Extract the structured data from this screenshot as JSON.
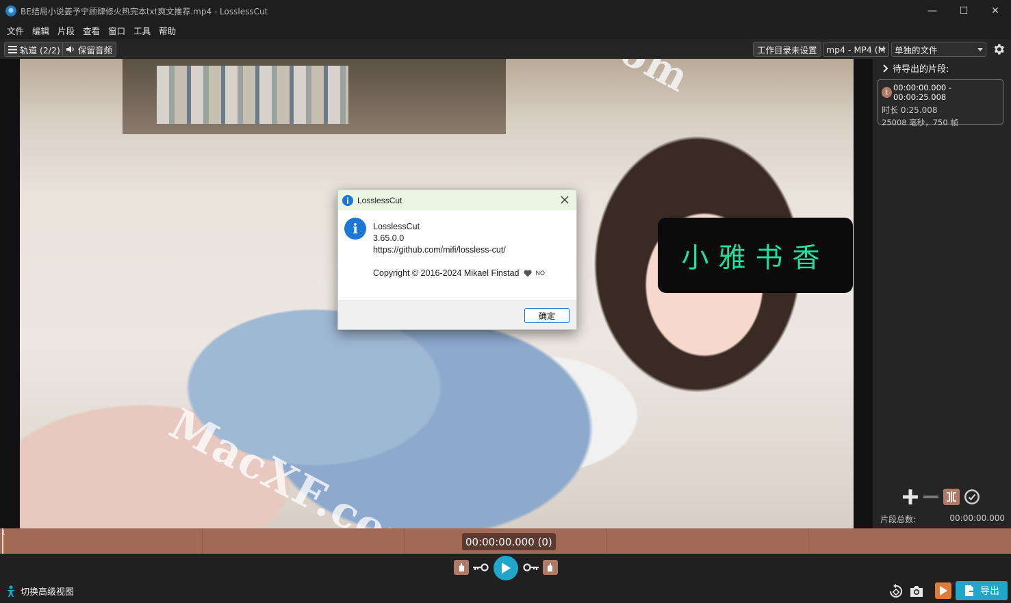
{
  "window": {
    "title": "BE结局小说姜予宁顾肆修火热完本txt爽文推荐.mp4 - LosslessCut",
    "controls": {
      "minimize": "—",
      "maximize": "☐",
      "close": "✕"
    }
  },
  "menu": [
    "文件",
    "编辑",
    "片段",
    "查看",
    "窗口",
    "工具",
    "帮助"
  ],
  "toolbar": {
    "tracks_label": "轨道 (2/2)",
    "keep_audio_label": "保留音频",
    "workdir_label": "工作目录未设置",
    "format_value": "mp4 - MP4 (M",
    "output_mode_value": "单独的文件",
    "settings_icon": "gear-icon"
  },
  "video": {
    "watermark_top": ".com",
    "watermark_bottom": "MacXF.com",
    "logo_text": "小雅书香"
  },
  "segments_panel": {
    "header": "待导出的片段:",
    "segments": [
      {
        "number": "1",
        "range": "00:00:00.000 - 00:00:25.008",
        "duration": "时长 0:25.008",
        "detail": "25008 毫秒，750 帧"
      }
    ],
    "total_label": "片段总数:",
    "total_value": "00:00:00.000"
  },
  "timeline": {
    "cursor_label": "1",
    "current_time": "00:00:00.000 (0)"
  },
  "bottom": {
    "advanced_view_label": "切换高级视图",
    "export_label": "导出"
  },
  "dialog": {
    "title": "LosslessCut",
    "app_name": "LosslessCut",
    "version": "3.65.0.0",
    "url": "https://github.com/mifi/lossless-cut/",
    "copyright": "Copyright © 2016-2024 Mikael Finstad",
    "country": "NO",
    "ok_label": "确定"
  },
  "colors": {
    "accent": "#1fa6c9",
    "timeline": "#a26a55",
    "logo_green": "#1fe09e"
  }
}
